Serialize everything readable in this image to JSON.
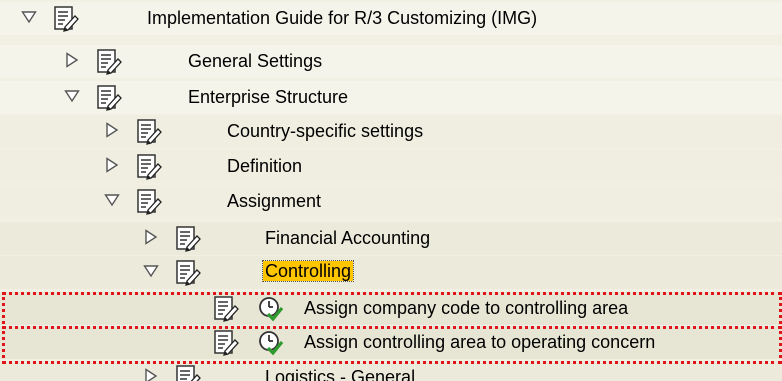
{
  "tree": {
    "root": {
      "label": "Implementation Guide for R/3 Customizing (IMG)",
      "state": "expanded"
    },
    "general_settings": {
      "label": "General Settings",
      "state": "collapsed"
    },
    "enterprise_structure": {
      "label": "Enterprise Structure",
      "state": "expanded"
    },
    "country_specific": {
      "label": "Country-specific settings",
      "state": "collapsed"
    },
    "definition": {
      "label": "Definition",
      "state": "collapsed"
    },
    "assignment": {
      "label": "Assignment",
      "state": "expanded"
    },
    "financial_accounting": {
      "label": "Financial Accounting",
      "state": "collapsed"
    },
    "controlling": {
      "label": "Controlling",
      "state": "expanded",
      "selected": true
    },
    "assign_company_code": {
      "label": "Assign company code to controlling area"
    },
    "assign_controlling_area": {
      "label": "Assign controlling area to operating concern"
    },
    "logistics_general": {
      "label": "Logistics - General",
      "state": "collapsed"
    }
  },
  "colors": {
    "selection_highlight": "#ffc600",
    "annotation_dashes": "#e0141b"
  },
  "icons": {
    "node": "document-pencil-icon",
    "activity": "clock-check-icon",
    "expand": "triangle-right-icon",
    "collapse": "triangle-down-icon"
  }
}
